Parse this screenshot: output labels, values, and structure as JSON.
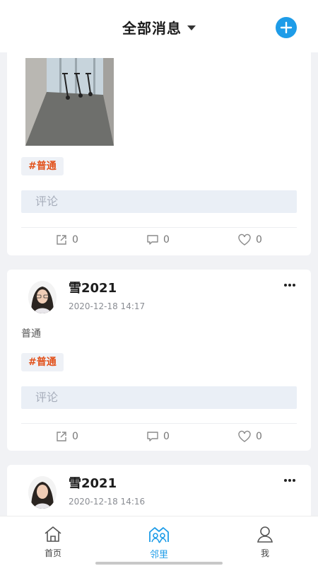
{
  "header": {
    "title": "全部消息",
    "add_icon": "plus-icon",
    "accent": "#1e9ce8"
  },
  "posts": [
    {
      "tag": "#普通",
      "comment_placeholder": "评论",
      "share_count": "0",
      "comment_count": "0",
      "like_count": "0"
    },
    {
      "username": "雪2021",
      "timestamp": "2020-12-18 14:17",
      "text": "普通",
      "tag": "#普通",
      "comment_placeholder": "评论",
      "share_count": "0",
      "comment_count": "0",
      "like_count": "0"
    },
    {
      "username": "雪2021",
      "timestamp": "2020-12-18 14:16"
    }
  ],
  "tabbar": {
    "items": [
      {
        "label": "首页",
        "icon": "home-icon"
      },
      {
        "label": "邻里",
        "icon": "neighborhood-icon",
        "active": true
      },
      {
        "label": "我",
        "icon": "profile-icon"
      }
    ]
  },
  "colors": {
    "tag_text": "#e2531d",
    "background": "#f1f2f5"
  }
}
